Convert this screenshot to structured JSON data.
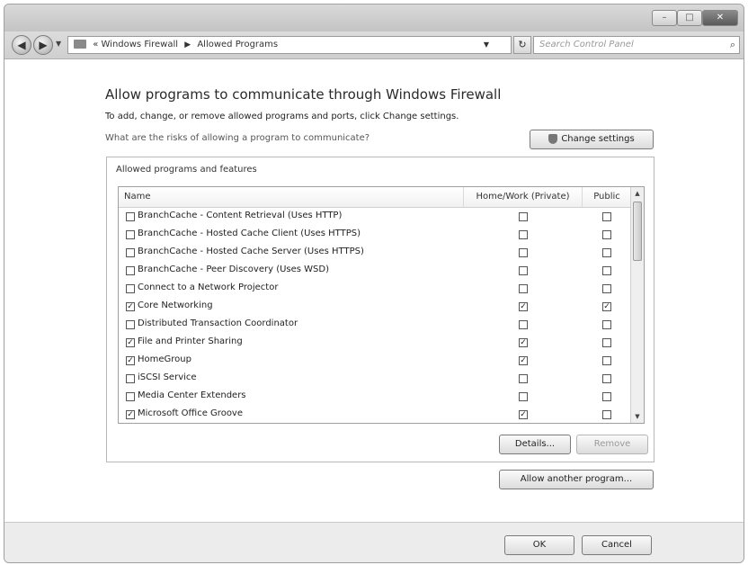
{
  "navbar": {
    "breadcrumb": [
      "Windows Firewall",
      "Allowed Programs"
    ],
    "breadcrumb_prefix": "«",
    "search_placeholder": "Search Control Panel"
  },
  "main": {
    "heading": "Allow programs to communicate through Windows Firewall",
    "subheading": "To add, change, or remove allowed programs and ports, click Change settings.",
    "risk_link": "What are the risks of allowing a program to communicate?",
    "change_settings_label": "Change settings",
    "group_title": "Allowed programs and features",
    "columns": {
      "name": "Name",
      "home": "Home/Work (Private)",
      "public": "Public"
    },
    "programs": [
      {
        "name": "BranchCache - Content Retrieval (Uses HTTP)",
        "enabled": false,
        "home": false,
        "public": false
      },
      {
        "name": "BranchCache - Hosted Cache Client (Uses HTTPS)",
        "enabled": false,
        "home": false,
        "public": false
      },
      {
        "name": "BranchCache - Hosted Cache Server (Uses HTTPS)",
        "enabled": false,
        "home": false,
        "public": false
      },
      {
        "name": "BranchCache - Peer Discovery (Uses WSD)",
        "enabled": false,
        "home": false,
        "public": false
      },
      {
        "name": "Connect to a Network Projector",
        "enabled": false,
        "home": false,
        "public": false
      },
      {
        "name": "Core Networking",
        "enabled": true,
        "home": true,
        "public": true
      },
      {
        "name": "Distributed Transaction Coordinator",
        "enabled": false,
        "home": false,
        "public": false
      },
      {
        "name": "File and Printer Sharing",
        "enabled": true,
        "home": true,
        "public": false
      },
      {
        "name": "HomeGroup",
        "enabled": true,
        "home": true,
        "public": false
      },
      {
        "name": "iSCSI Service",
        "enabled": false,
        "home": false,
        "public": false
      },
      {
        "name": "Media Center Extenders",
        "enabled": false,
        "home": false,
        "public": false
      },
      {
        "name": "Microsoft Office Groove",
        "enabled": true,
        "home": true,
        "public": false
      }
    ],
    "details_label": "Details...",
    "remove_label": "Remove",
    "allow_another_label": "Allow another program..."
  },
  "footer": {
    "ok_label": "OK",
    "cancel_label": "Cancel"
  },
  "icons": {
    "back": "back-arrow-icon",
    "forward": "forward-arrow-icon",
    "folder": "control-panel-icon",
    "refresh": "refresh-icon",
    "search": "search-icon",
    "shield": "uac-shield-icon"
  }
}
